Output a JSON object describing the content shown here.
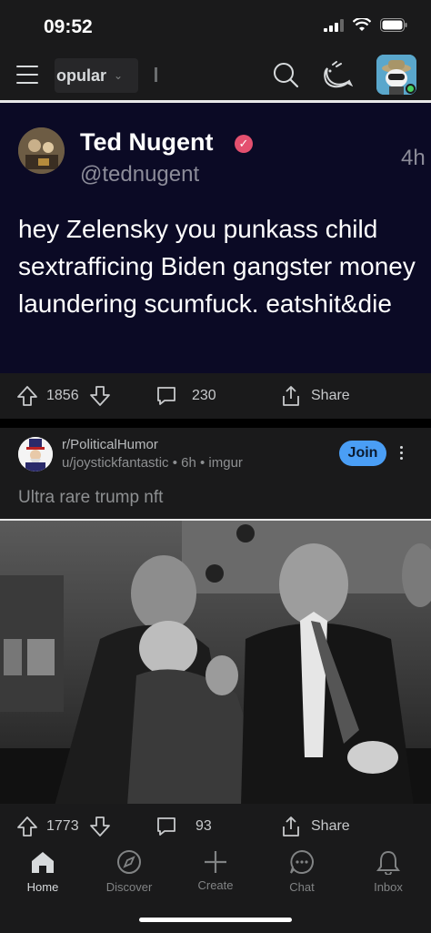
{
  "status_bar": {
    "time": "09:52"
  },
  "nav": {
    "feed_label": "opular"
  },
  "tweet": {
    "name": "Ted Nugent",
    "handle": "@tednugent",
    "time": "4h",
    "text": "hey Zelensky you punkass child sextrafficing Biden gangster money laundering scumfuck. eatshit&die"
  },
  "post1_actions": {
    "upvotes": "1856",
    "comments": "230",
    "share": "Share"
  },
  "post2": {
    "subreddit": "r/PoliticalHumor",
    "meta": "u/joystickfantastic • 6h • imgur",
    "join": "Join",
    "title": "Ultra rare trump nft"
  },
  "post2_actions": {
    "upvotes": "1773",
    "comments": "93",
    "share": "Share"
  },
  "tabs": [
    {
      "label": "Home",
      "icon": "home-icon"
    },
    {
      "label": "Discover",
      "icon": "compass-icon"
    },
    {
      "label": "Create",
      "icon": "plus-icon"
    },
    {
      "label": "Chat",
      "icon": "chat-bubble-icon"
    },
    {
      "label": "Inbox",
      "icon": "bell-icon"
    }
  ],
  "colors": {
    "tweet_bg": "#0b0a25",
    "join": "#4a9ef5",
    "verified": "#e4506f",
    "online": "#46d160"
  }
}
